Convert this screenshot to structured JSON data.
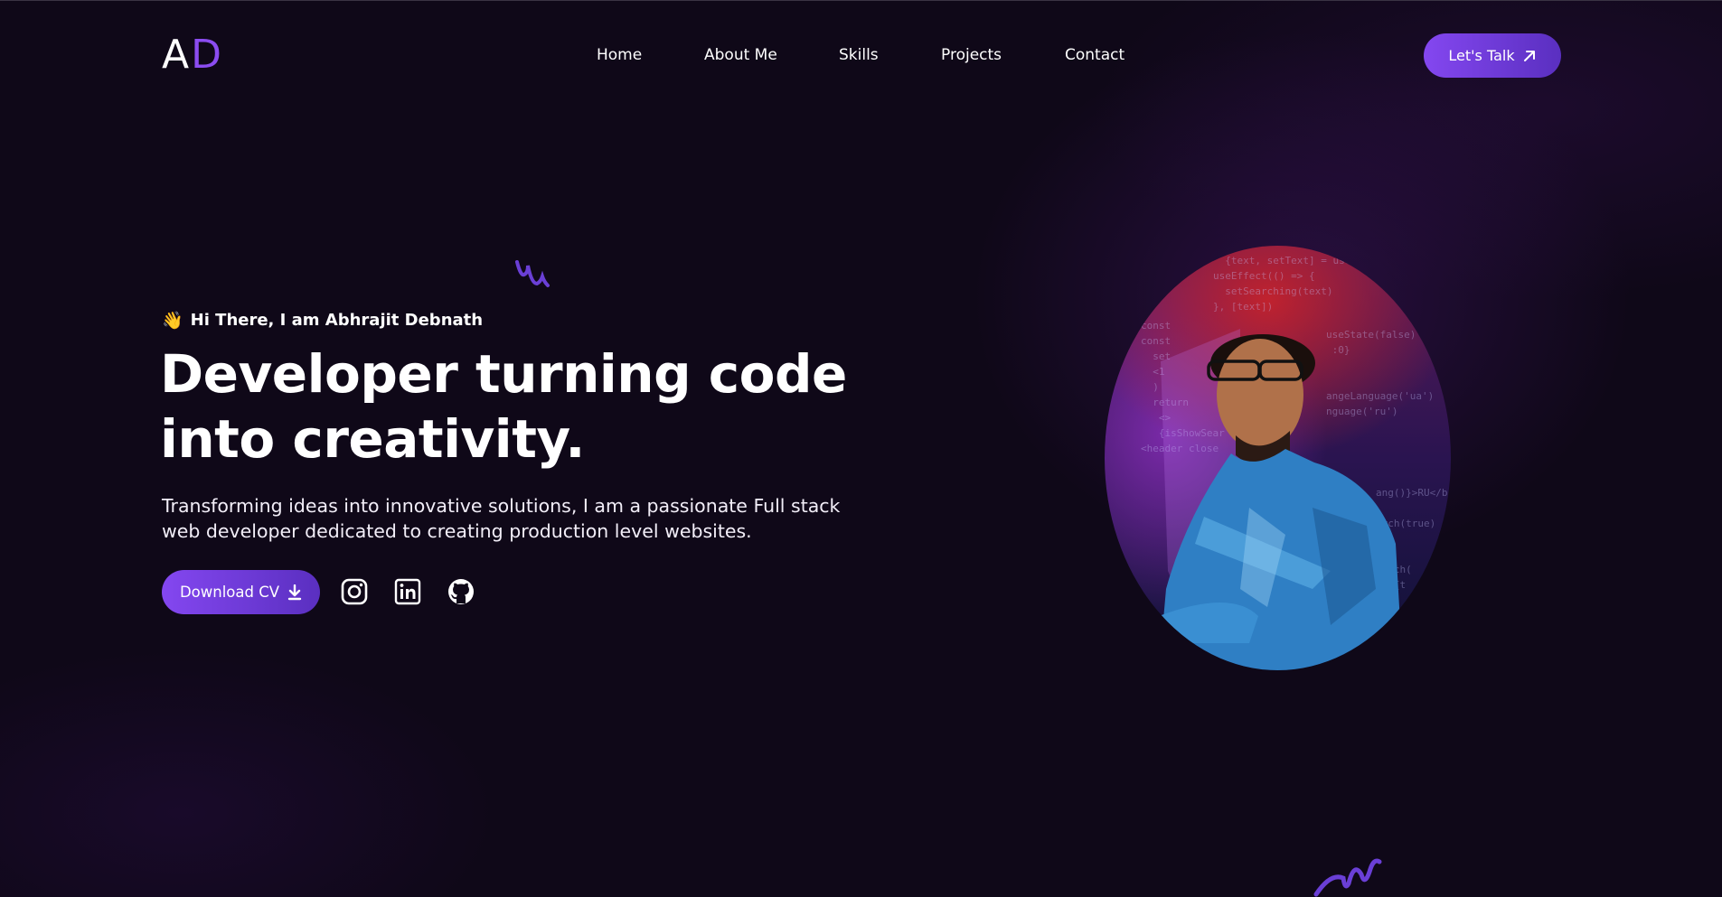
{
  "header": {
    "logo": {
      "first": "A",
      "second": "D"
    },
    "nav": [
      "Home",
      "About Me",
      "Skills",
      "Projects",
      "Contact"
    ],
    "cta_label": "Let's Talk"
  },
  "hero": {
    "greeting_emoji": "👋",
    "greeting": "Hi There, I am Abhrajit Debnath",
    "headline_line1": "Developer turning code",
    "headline_line2": "into creativity.",
    "desc_line1": "Transforming ideas into innovative solutions, I am a passionate Full stack",
    "desc_line2": "web developer dedicated to creating production level websites.",
    "download_label": "Download CV",
    "social": [
      "instagram-icon",
      "linkedin-icon",
      "github-icon"
    ]
  },
  "colors": {
    "background": "#0f0818",
    "accent": "#8447f0",
    "accent_dark": "#5a2fc0",
    "logo_accent": "#8b4cf0"
  }
}
